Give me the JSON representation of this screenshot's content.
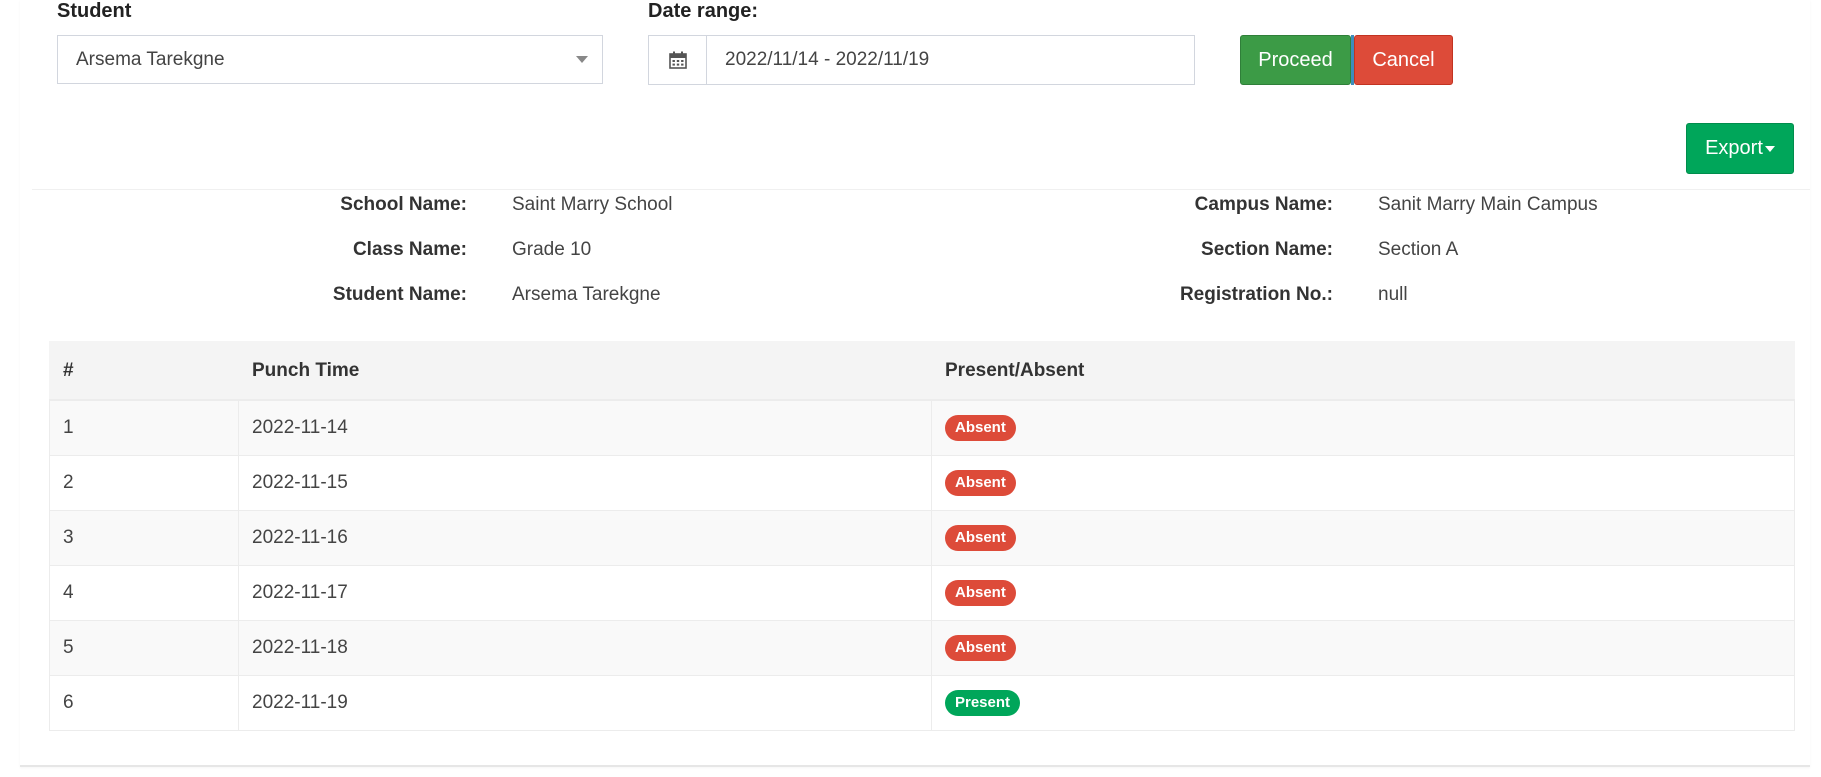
{
  "filters": {
    "student_label": "Student",
    "student_value": "Arsema Tarekgne",
    "date_label": "Date range:",
    "date_value": "2022/11/14 - 2022/11/19"
  },
  "buttons": {
    "proceed": "Proceed",
    "cancel": "Cancel",
    "export": "Export"
  },
  "info": {
    "school_label": "School Name:",
    "school_value": "Saint Marry School",
    "campus_label": "Campus Name:",
    "campus_value": "Sanit Marry Main Campus",
    "class_label": "Class Name:",
    "class_value": "Grade 10",
    "section_label": "Section Name:",
    "section_value": "Section A",
    "student_label": "Student Name:",
    "student_value": "Arsema Tarekgne",
    "reg_label": "Registration No.:",
    "reg_value": "null"
  },
  "table": {
    "headers": [
      "#",
      "Punch Time",
      "Present/Absent"
    ],
    "rows": [
      {
        "num": "1",
        "time": "2022-11-14",
        "status": "Absent"
      },
      {
        "num": "2",
        "time": "2022-11-15",
        "status": "Absent"
      },
      {
        "num": "3",
        "time": "2022-11-16",
        "status": "Absent"
      },
      {
        "num": "4",
        "time": "2022-11-17",
        "status": "Absent"
      },
      {
        "num": "5",
        "time": "2022-11-18",
        "status": "Absent"
      },
      {
        "num": "6",
        "time": "2022-11-19",
        "status": "Present"
      }
    ]
  },
  "colors": {
    "absent": "#dd4b39",
    "present": "#00a65a",
    "proceed": "#3c9b46",
    "cancel": "#dd4b39",
    "export": "#00a65a"
  },
  "icons": {
    "date": "calendar-icon",
    "select": "chevron-down-icon",
    "export": "caret-down-icon"
  }
}
